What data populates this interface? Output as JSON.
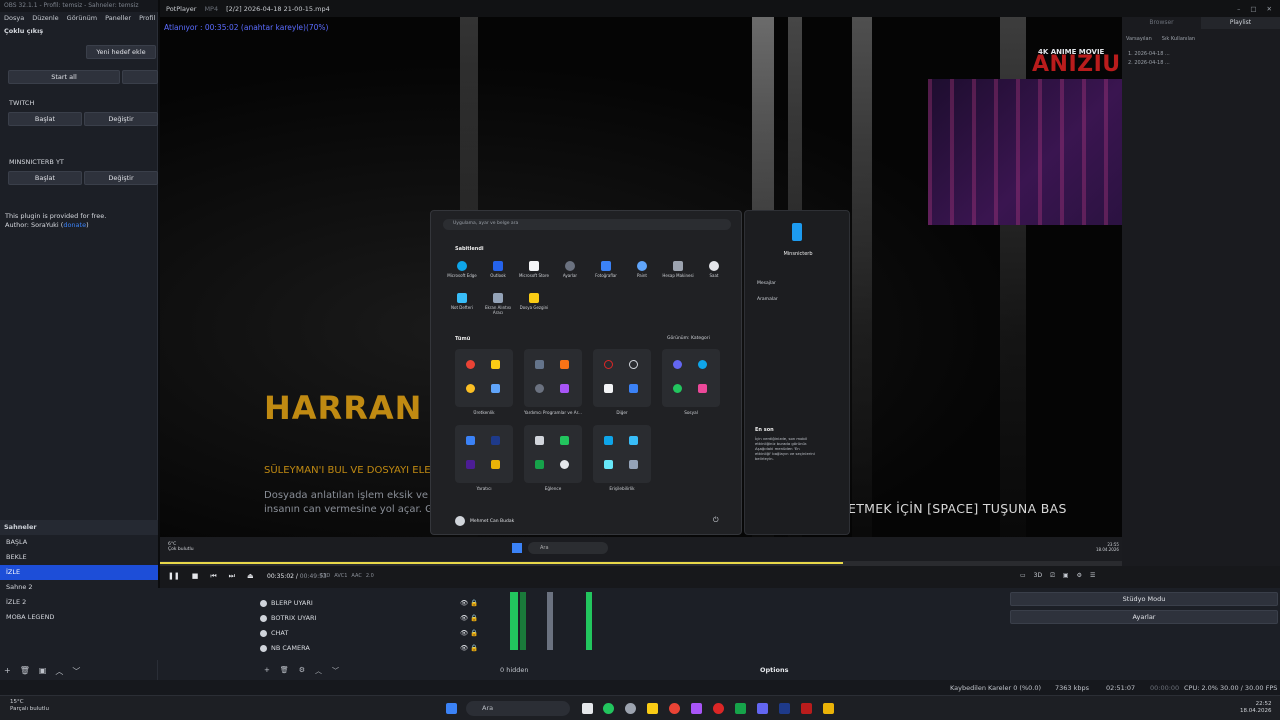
{
  "obs": {
    "title": "OBS 32.1.1 - Profil: temsiz - Sahneler: temsiz",
    "menu": [
      "Dosya",
      "Düzenle",
      "Görünüm",
      "Paneller",
      "Profil",
      "S"
    ],
    "multi_output_title": "Çoklu çıkış",
    "add_target": "Yeni hedef ekle",
    "start_all": "Start all",
    "twitch_label": "TWITCH",
    "youtube_label": "MINSNICTERB YT",
    "start": "Başlat",
    "change": "Değiştir",
    "plugin_note": "This plugin is provided for free.",
    "author_prefix": "Author: SoraYuki (",
    "author_link": "donate",
    "author_suffix": ")",
    "scenes_header": "Sahneler",
    "scenes": [
      "BAŞLA",
      "BEKLE",
      "İZLE",
      "Sahne 2",
      "İZLE 2",
      "MOBA LEGEND"
    ],
    "selected_scene": "İZLE",
    "sources": [
      "BLERP UYARI",
      "BOTRIX UYARI",
      "CHAT",
      "NB CAMERA"
    ],
    "hidden_count": "0 hidden",
    "options": "Options",
    "studio_mode": "Stüdyo Modu",
    "settings": "Ayarlar",
    "status": {
      "dropped": "Kaybedilen Kareler 0 (%0.0)",
      "bitrate": "7363 kbps",
      "rec_time": "02:51:07",
      "live_time": "00:00:00",
      "cpu": "CPU: 2.0%",
      "fps": "30.00 / 30.00 FPS"
    }
  },
  "potplayer": {
    "app": "PotPlayer",
    "format": "MP4",
    "file": "[2/2] 2026-04-18 21-00-15.mp4",
    "skip_hint": "Atlanıyor : 00:35:02 (anahtar kareyle)(70%)",
    "time_current": "00:35:02",
    "time_total": "00:49:53",
    "badges": [
      "S3D",
      "AVC1",
      "AAC",
      "2.0"
    ],
    "progress": 0.71,
    "tabs": [
      "Browser",
      "Playlist"
    ],
    "playlist_tabs": [
      "Varsayılan",
      "Sık Kullanılan"
    ],
    "playlist_items": [
      "1. 2026-04-18 ...",
      "2. 2026-04-18 ..."
    ]
  },
  "video": {
    "game_title": "HARRAN Ş",
    "mission": "SÜLEYMAN'I BUL VE DOSYAYI ELE",
    "desc_line1": "Dosyada anlatılan işlem eksik ve (şu",
    "desc_line2": "insanın can vermesine yol açar. Geri",
    "space_hint": "ETMEK İÇİN [SPACE] TUŞUNA BAS",
    "watermark_small": "4K ANIME MOVIE",
    "watermark_big": "ANIZIUM"
  },
  "startmenu": {
    "search_placeholder": "Uygulama, ayar ve belge ara",
    "pinned": "Sabitlendi",
    "pinned_apps": [
      "Microsoft Edge",
      "Outlook",
      "Microsoft Store",
      "Ayarlar",
      "Fotoğraflar",
      "Paint",
      "Hesap Makinesi",
      "Saat",
      "Not Defteri",
      "Ekran Alıntısı Aracı",
      "Dosya Gezgini"
    ],
    "all": "Tümü",
    "view": "Görünüm: Kategori",
    "groups": [
      "Üretkenlik",
      "Yardımcı Programlar ve Ar...",
      "Diğer",
      "Sosyal",
      "Yaratıcı",
      "Eğlence",
      "Erişilebilirlik"
    ],
    "user": "Mehmet Can Budak",
    "phone_name": "Minsnicterb",
    "phone_actions": [
      "Mesajlar",
      "Aramalar"
    ],
    "recent_title": "En son",
    "recent_text": "İçin verdiğinizde, son mobil etkinliğiniz burada görünür. Aşağıdaki menüden 'En etkinliği' bağlayın ve seçinlerini belirleyin."
  },
  "inner_taskbar": {
    "weather_temp": "6°C",
    "weather_text": "Çok bulutlu",
    "search": "Ara",
    "time": "23:55",
    "date": "18.04.2026"
  },
  "taskbar": {
    "weather_temp": "15°C",
    "weather_text": "Parçalı bulutlu",
    "search": "Ara",
    "time": "22:52",
    "date": "18.04.2026"
  },
  "colors": {
    "accent": "#1d4ed8",
    "game_gold": "#c08a12",
    "green_meter": "#22c55e"
  }
}
